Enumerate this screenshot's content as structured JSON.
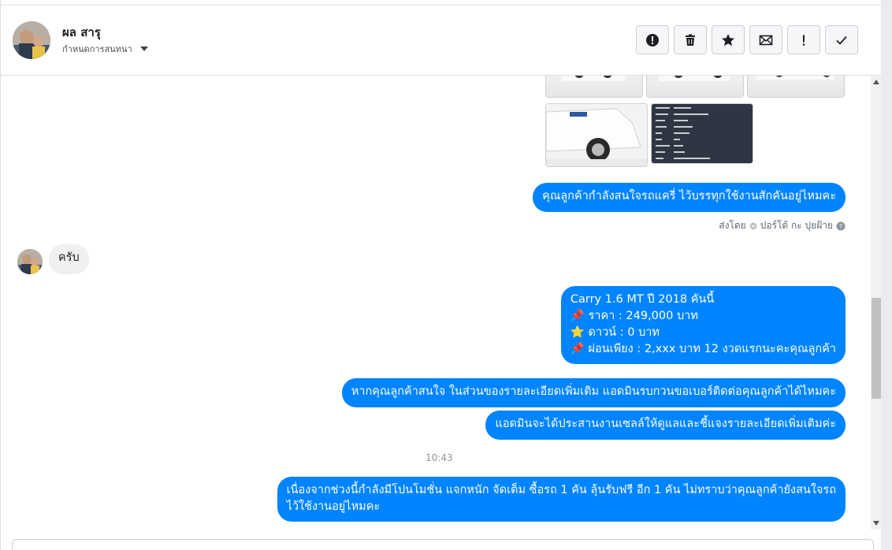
{
  "header": {
    "contact_name": "ผล สารุ",
    "assign_label": "กำหนดการสนทนา",
    "toolbar": [
      {
        "name": "report-button",
        "icon": "exclamation-circle-icon"
      },
      {
        "name": "delete-button",
        "icon": "trash-icon"
      },
      {
        "name": "star-button",
        "icon": "star-icon"
      },
      {
        "name": "mark-unread-button",
        "icon": "envelope-icon"
      },
      {
        "name": "follow-up-button",
        "icon": "exclamation-icon"
      },
      {
        "name": "done-button",
        "icon": "checkmark-icon"
      }
    ]
  },
  "messages": {
    "question_text": "คุณลูกค้ากำลังสนใจรถแครี่ ไว้บรรทุกใช้งานสักคันอยู่ไหมคะ",
    "sent_by_label": "ส่งโดย",
    "sender_name": "ปอร์โต้ กะ ปุยฝ้าย",
    "reply_text": "ครับ",
    "offer_lines": [
      "Carry 1.6 MT  ปี 2018 คันนี้",
      "📌 ราคา : 249,000 บาท",
      "⭐ ดาวน์ : 0 บาท",
      "📌 ผ่อนเพียง : 2,xxx บาท 12 งวดแรกนะคะคุณลูกค้า"
    ],
    "phone_request": "หากคุณลูกค้าสนใจ ในส่วนของรายละเอียดเพิ่มเติม แอดมินรบกวนขอเบอร์ติดต่อคุณลูกค้าได้ไหมคะ",
    "coordinate_note": "แอดมินจะได้ประสานงานเซลล์ให้ดูแลและชี้แจงรายละเอียดเพิ่มเติมค่ะ",
    "timestamp": "10:43",
    "promo_lines": [
      "เนื่องจากช่วงนี้กำลังมีโปนโมชั่น แจกหนัก จัดเต็ม ซื้อรถ 1 คัน ลุ้นรับฟรี อีก 1 คัน ไม่ทราบว่าคุณลูกค้ายังสนใจรถ",
      "ไว้ใช้งานอยู่ไหมคะ"
    ]
  },
  "colors": {
    "accent": "#0084ff",
    "incoming_bubble": "#f0f0f0"
  }
}
